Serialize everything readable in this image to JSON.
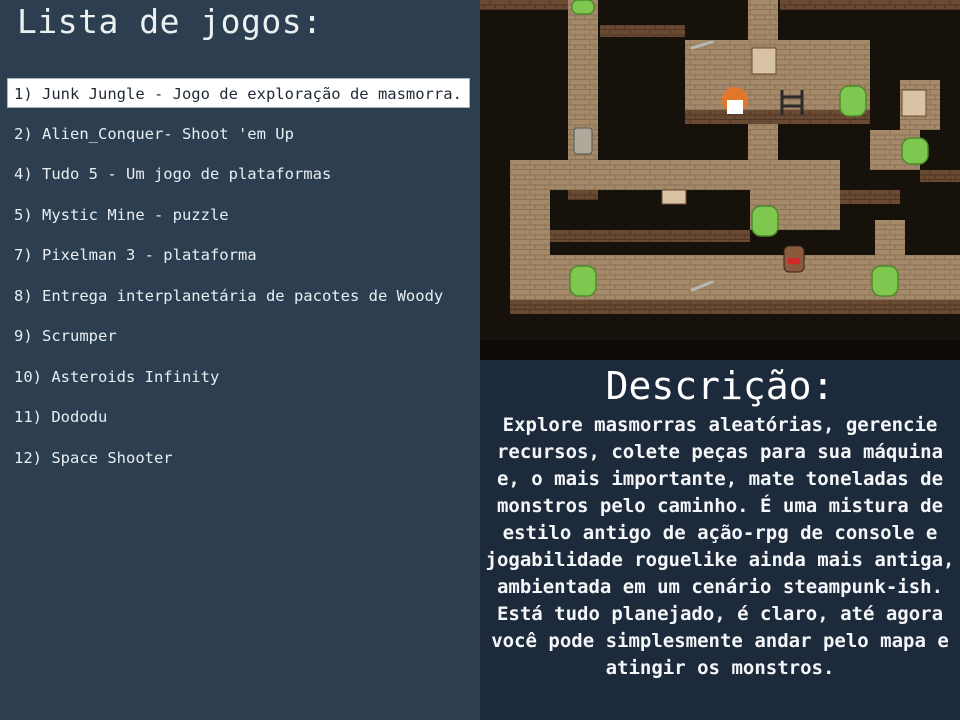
{
  "list_title": "Lista de jogos:",
  "games": [
    "1) Junk Jungle - Jogo de exploração de masmorra.",
    "2) Alien_Conquer- Shoot 'em Up",
    "4) Tudo 5 - Um jogo de plataformas",
    "5) Mystic Mine - puzzle",
    "7) Pixelman 3 - plataforma",
    "8) Entrega interplanetária de pacotes de Woody",
    "9) Scrumper",
    "10) Asteroids Infinity",
    "11) Dododu",
    "12) Space Shooter"
  ],
  "selected_index": 0,
  "description": {
    "title": "Descrição:",
    "text": "Explore masmorras aleatórias, gerencie recursos, colete peças para sua máquina e, o mais importante, mate toneladas de monstros pelo caminho. É uma mistura de estilo antigo de ação-rpg de console e jogabilidade roguelike ainda mais antiga, ambientada em um cenário steampunk-ish. Está tudo planejado, é claro, até agora você pode simplesmente andar pelo mapa e atingir os monstros."
  },
  "colors": {
    "left_bg": "#2c3e50",
    "desc_bg": "#1c2a3b",
    "floor": "#a58a6a",
    "wall": "#1a1410",
    "slime": "#7ec850"
  }
}
